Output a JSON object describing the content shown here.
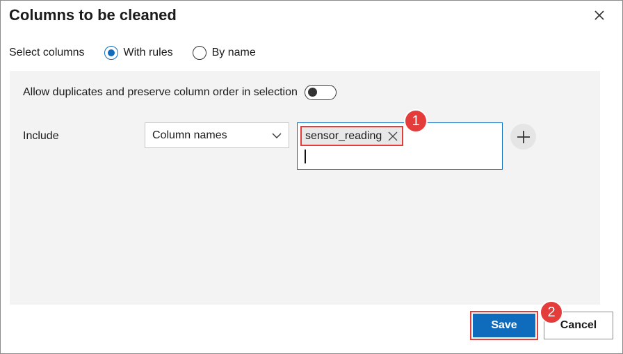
{
  "dialog": {
    "title": "Columns to be cleaned",
    "close_icon": "close-icon"
  },
  "select_columns": {
    "label": "Select columns",
    "options": [
      {
        "label": "With rules",
        "checked": true
      },
      {
        "label": "By name",
        "checked": false
      }
    ]
  },
  "rules_panel": {
    "duplicates_label": "Allow duplicates and preserve column order in selection",
    "duplicates_toggle_on": false,
    "include_label": "Include",
    "dropdown_value": "Column names",
    "tags": [
      "sensor_reading"
    ],
    "add_icon": "plus-icon"
  },
  "annotations": {
    "badge_1": "1",
    "badge_2": "2",
    "highlight_color": "#e43b3b"
  },
  "footer": {
    "save_label": "Save",
    "cancel_label": "Cancel"
  },
  "colors": {
    "accent": "#0f6cbd",
    "panel_bg": "#f3f3f3"
  }
}
